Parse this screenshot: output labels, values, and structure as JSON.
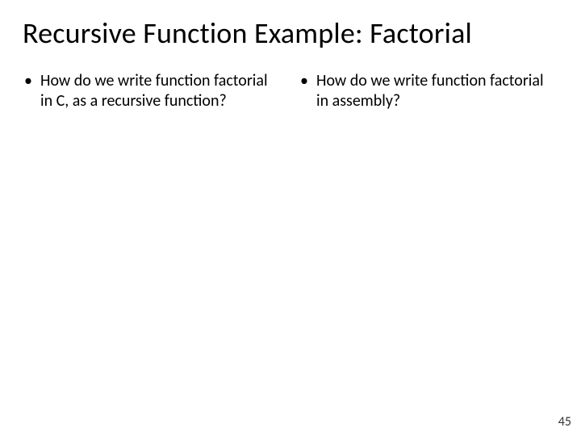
{
  "title": "Recursive Function Example: Factorial",
  "left_column": {
    "bullet_text": "How do we write function factorial in C, as a recursive function?"
  },
  "right_column": {
    "bullet_text": "How do we write function factorial in assembly?"
  },
  "bullet_glyph": "•",
  "page_number": "45"
}
